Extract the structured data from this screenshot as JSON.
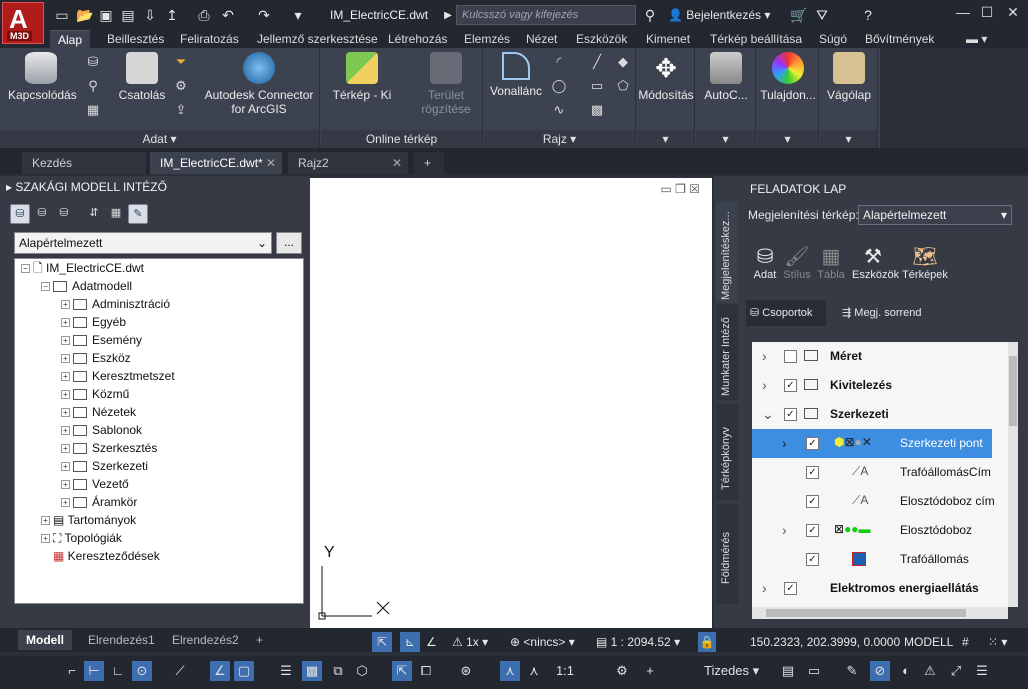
{
  "app": {
    "logo_top": "A",
    "logo_bottom": "M3D",
    "doc_title": "IM_ElectricCE.dwt",
    "search_placeholder": "Kulcsszó vagy kifejezés",
    "login": "Bejelentkezés"
  },
  "ribbon_tabs": [
    "Alap",
    "Beillesztés",
    "Feliratozás",
    "Jellemző szerkesztése",
    "Létrehozás",
    "Elemzés",
    "Nézet",
    "Eszközök",
    "Kimenet",
    "Térkép beállítása",
    "Súgó",
    "Bővítmények"
  ],
  "ribbon": {
    "connect": "Kapcsolódás",
    "attach": "Csatolás",
    "arcgis_1": "Autodesk Connector",
    "arcgis_2": "for ArcGIS",
    "panel_data": "Adat",
    "map_off": "Térkép - Ki",
    "area_1": "Terület",
    "area_2": "rögzítése",
    "panel_online": "Online térkép",
    "polyline": "Vonallánc",
    "panel_draw": "Rajz",
    "modify": "Módosítás",
    "autocad": "AutoC...",
    "props": "Tulajdon...",
    "clipboard": "Vágólap"
  },
  "doc_tabs": [
    {
      "label": "Kezdés"
    },
    {
      "label": "IM_ElectricCE.dwt*"
    },
    {
      "label": "Rajz2"
    }
  ],
  "left_panel": {
    "title": "SZAKÁGI MODELL INTÉZŐ",
    "select_value": "Alapértelmezett",
    "more_label": "...",
    "tree": {
      "root": "IM_ElectricCE.dwt",
      "datamodel": "Adatmodell",
      "items": [
        "Adminisztráció",
        "Egyéb",
        "Esemény",
        "Eszköz",
        "Keresztmetszet",
        "Közmű",
        "Nézetek",
        "Sablonok",
        "Szerkesztés",
        "Szerkezeti",
        "Vezető",
        "Áramkör"
      ],
      "domains": "Tartományok",
      "topologies": "Topológiák",
      "intersections": "Kereszteződések"
    }
  },
  "canvas": {
    "y_axis": "Y"
  },
  "right_panel": {
    "title": "FELADATOK LAP",
    "vtabs": [
      "Megjelenítéskez...",
      "Munkater Intéző",
      "Térképkönyv",
      "Földmérés"
    ],
    "map_label": "Megjelenítési térkép:",
    "map_value": "Alapértelmezett",
    "icons": [
      "Adat",
      "Stílus",
      "Tábla",
      "Eszközök",
      "Térképek"
    ],
    "groups_btn": "Csoportok",
    "order_btn": "Megj. sorrend",
    "layers": [
      {
        "label": "Méret",
        "checked": false,
        "bold": true
      },
      {
        "label": "Kivitelezés",
        "checked": true,
        "bold": true
      },
      {
        "label": "Szerkezeti",
        "checked": true,
        "bold": true
      },
      {
        "label": "Szerkezeti pont",
        "checked": true,
        "selected": true
      },
      {
        "label": "TrafóállomásCím",
        "checked": true
      },
      {
        "label": "Elosztódoboz cím",
        "checked": true
      },
      {
        "label": "Elosztódoboz",
        "checked": true
      },
      {
        "label": "Trafóállomás",
        "checked": true
      },
      {
        "label": "Elektromos energiaellátás",
        "checked": true,
        "bold": true
      }
    ]
  },
  "layout_tabs": [
    "Modell",
    "Elrendezés1",
    "Elrendezés2"
  ],
  "status": {
    "scale_mult": "1x",
    "nincs": "<nincs>",
    "scale": "1 : 2094.52",
    "coords": "150.2323, 202.3999, 0.0000",
    "model": "MODELL",
    "ratio": "1:1",
    "units": "Tizedes"
  }
}
